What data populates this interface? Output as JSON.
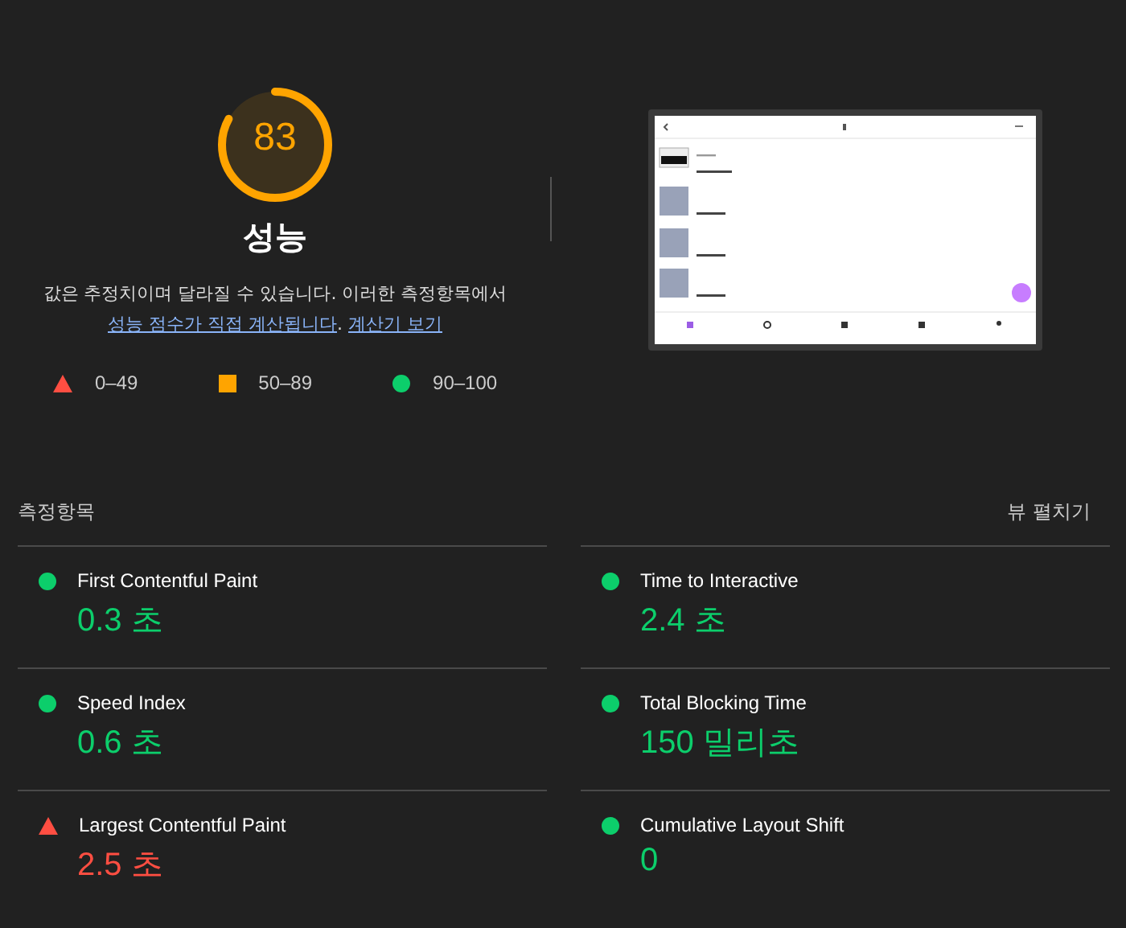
{
  "gauge": {
    "score": "83",
    "level": 0.83,
    "color": "#ffa400",
    "title": "성능"
  },
  "description": {
    "text": "값은 추정치이며 달라질 수 있습니다. 이러한 측정항목에서 ",
    "link1": "성능 점수가 직접 계산됩니다",
    "separator": ". ",
    "link2": "계산기 보기"
  },
  "legend": [
    {
      "kind": "triangle",
      "color": "#ff4e42",
      "label": "0–49"
    },
    {
      "kind": "square",
      "color": "#ffa400",
      "label": "50–89"
    },
    {
      "kind": "circle",
      "color": "#0cce6b",
      "label": "90–100"
    }
  ],
  "metrics_header": {
    "title": "측정항목",
    "toggle": "뷰 펼치기"
  },
  "metrics": [
    {
      "name": "First Contentful Paint",
      "value": "0.3 초",
      "kind": "circle",
      "color": "#0cce6b"
    },
    {
      "name": "Time to Interactive",
      "value": "2.4 초",
      "kind": "circle",
      "color": "#0cce6b"
    },
    {
      "name": "Speed Index",
      "value": "0.6 초",
      "kind": "circle",
      "color": "#0cce6b"
    },
    {
      "name": "Total Blocking Time",
      "value": "150 밀리초",
      "kind": "circle",
      "color": "#0cce6b"
    },
    {
      "name": "Largest Contentful Paint",
      "value": "2.5 초",
      "kind": "triangle",
      "color": "#ff4e42"
    },
    {
      "name": "Cumulative Layout Shift",
      "value": "0",
      "kind": "circle",
      "color": "#0cce6b"
    }
  ]
}
